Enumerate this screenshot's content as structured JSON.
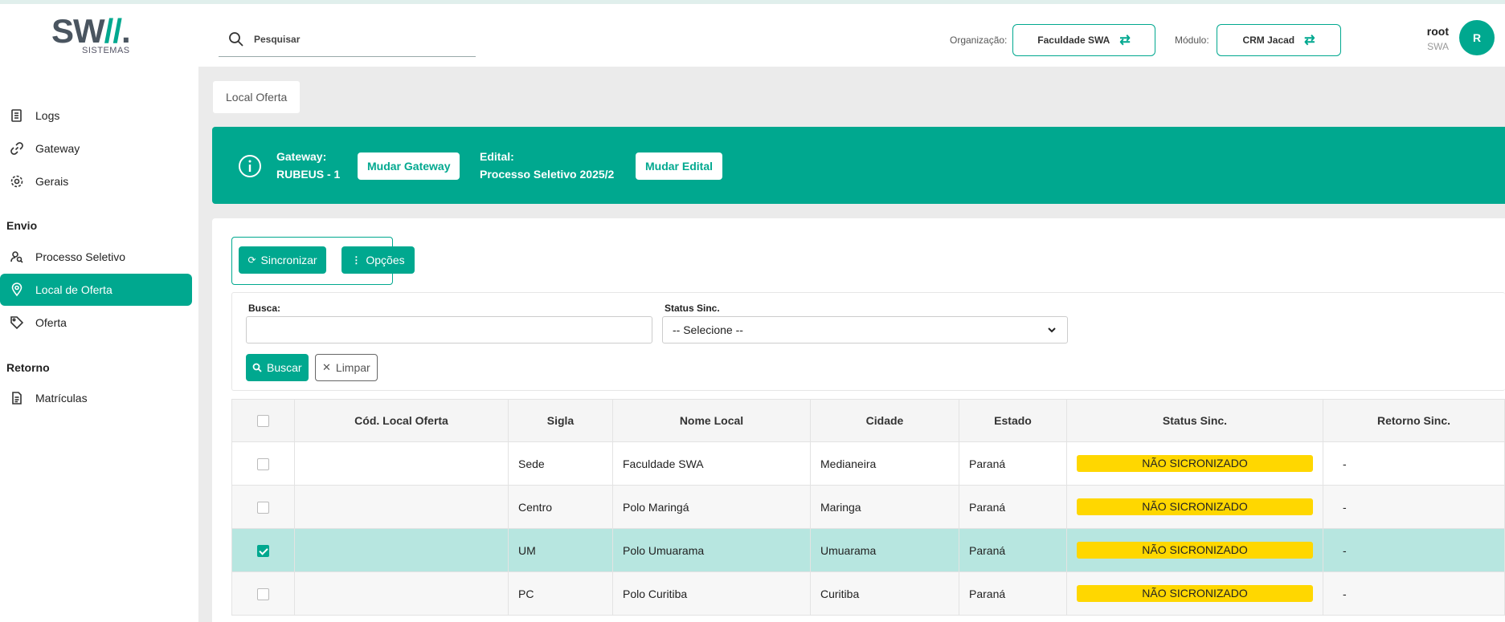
{
  "header": {
    "logo_text": "SWA.",
    "logo_sub": "SISTEMAS",
    "search_placeholder": "Pesquisar",
    "org_label": "Organização:",
    "org_value": "Faculdade SWA",
    "module_label": "Módulo:",
    "module_value": "CRM Jacad",
    "user_name": "root",
    "user_org": "SWA",
    "avatar_initial": "R"
  },
  "sidebar": {
    "items": [
      {
        "label": "Logs",
        "icon": "log-icon"
      },
      {
        "label": "Gateway",
        "icon": "link-icon"
      },
      {
        "label": "Gerais",
        "icon": "gear-icon"
      }
    ],
    "section_envio": "Envio",
    "envio_items": [
      {
        "label": "Processo Seletivo",
        "icon": "user-search-icon"
      },
      {
        "label": "Local de Oferta",
        "icon": "location-pin-icon",
        "active": true
      },
      {
        "label": "Oferta",
        "icon": "tag-icon"
      }
    ],
    "section_retorno": "Retorno",
    "retorno_items": [
      {
        "label": "Matrículas",
        "icon": "document-icon"
      }
    ]
  },
  "breadcrumb": "Local Oferta",
  "banner": {
    "gateway_label": "Gateway:",
    "gateway_value": "RUBEUS - 1",
    "change_gateway": "Mudar Gateway",
    "edital_label": "Edital:",
    "edital_value": "Processo Seletivo 2025/2",
    "change_edital": "Mudar Edital"
  },
  "actions": {
    "sync": "Sincronizar",
    "options": "Opções"
  },
  "filter": {
    "search_label": "Busca:",
    "search_value": "",
    "status_label": "Status Sinc.",
    "status_value": "-- Selecione --",
    "search_button": "Buscar",
    "clear_button": "Limpar"
  },
  "table": {
    "columns": [
      "Cód. Local Oferta",
      "Sigla",
      "Nome Local",
      "Cidade",
      "Estado",
      "Status Sinc.",
      "Retorno Sinc."
    ],
    "rows": [
      {
        "cod": "",
        "sigla": "Sede",
        "nome": "Faculdade SWA",
        "cidade": "Medianeira",
        "estado": "Paraná",
        "status": "NÃO SICRONIZADO",
        "retorno": "-",
        "checked": false
      },
      {
        "cod": "",
        "sigla": "Centro",
        "nome": "Polo Maringá",
        "cidade": "Maringa",
        "estado": "Paraná",
        "status": "NÃO SICRONIZADO",
        "retorno": "-",
        "checked": false
      },
      {
        "cod": "",
        "sigla": "UM",
        "nome": "Polo Umuarama",
        "cidade": "Umuarama",
        "estado": "Paraná",
        "status": "NÃO SICRONIZADO",
        "retorno": "-",
        "checked": true
      },
      {
        "cod": "",
        "sigla": "PC",
        "nome": "Polo Curitiba",
        "cidade": "Curitiba",
        "estado": "Paraná",
        "status": "NÃO SICRONIZADO",
        "retorno": "-",
        "checked": false
      }
    ]
  },
  "colors": {
    "accent": "#00a88f",
    "badge": "#ffd700",
    "selected_row": "#b7e6e0"
  }
}
